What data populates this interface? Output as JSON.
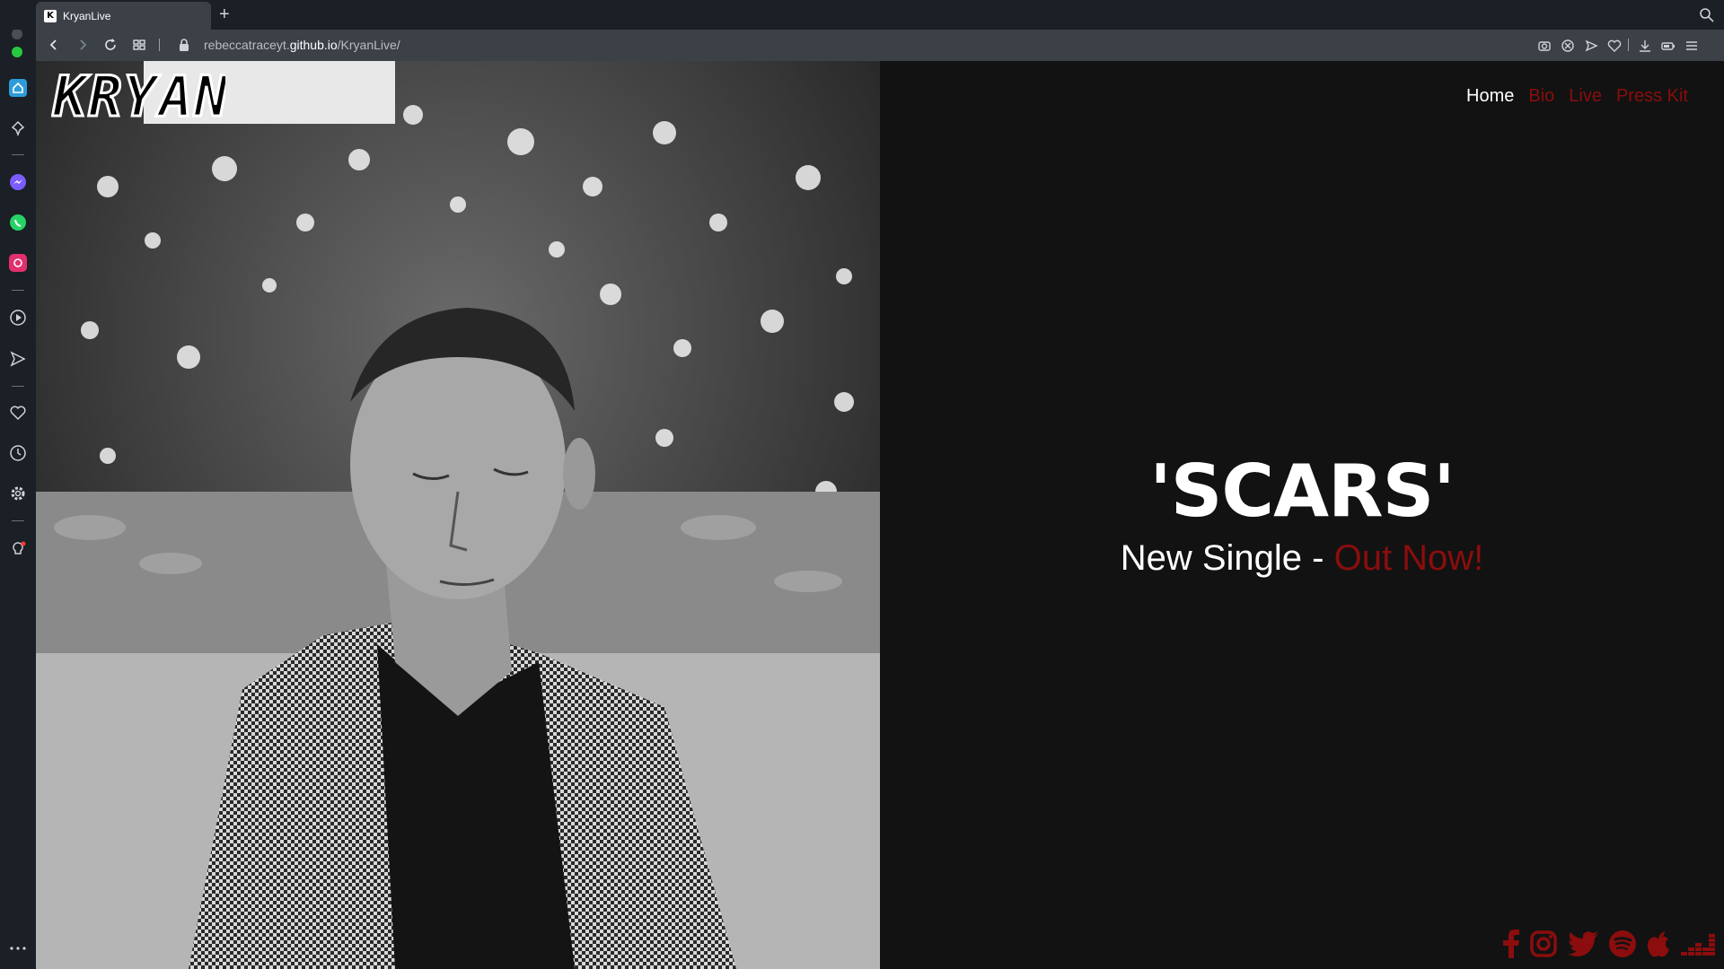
{
  "browser": {
    "tab_title": "KryanLive",
    "tab_favicon": "K",
    "url_prefix": "rebeccatraceyt.",
    "url_domain": "github.io",
    "url_path": "/KryanLive/"
  },
  "site": {
    "logo_text": "KRYAN",
    "nav": [
      {
        "label": "Home",
        "active": true
      },
      {
        "label": "Bio"
      },
      {
        "label": "Live"
      },
      {
        "label": "Press Kit"
      }
    ],
    "hero": {
      "title": "'SCARS'",
      "subtitle_prefix": "New Single - ",
      "subtitle_highlight": "Out Now!"
    },
    "social_icons": [
      "facebook-icon",
      "instagram-icon",
      "twitter-icon",
      "spotify-icon",
      "apple-icon",
      "deezer-icon"
    ]
  },
  "colors": {
    "accent": "#8b0d0d",
    "background": "#121212",
    "text": "#ffffff"
  }
}
